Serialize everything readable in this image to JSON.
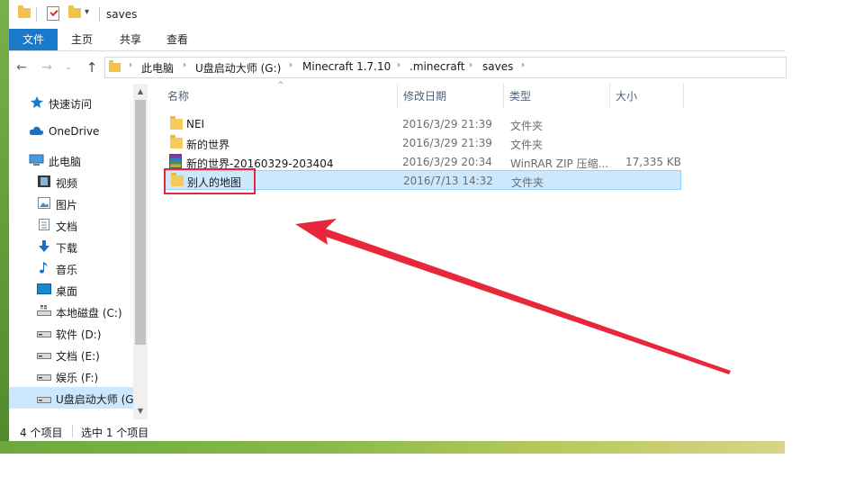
{
  "window": {
    "title": "saves",
    "qat_dropdown": "▾"
  },
  "ribbon": {
    "tabs": [
      {
        "label": "文件",
        "active": true
      },
      {
        "label": "主页"
      },
      {
        "label": "共享"
      },
      {
        "label": "查看"
      }
    ]
  },
  "nav": {
    "back": "←",
    "forward": "→",
    "history": "⌄",
    "up": "↑"
  },
  "address": {
    "crumbs": [
      "此电脑",
      "U盘启动大师 (G:)",
      "Minecraft 1.7.10",
      ".minecraft",
      "saves"
    ],
    "separator": "›"
  },
  "sidebar": {
    "items": [
      {
        "label": "快速访问",
        "icon": "star-icon"
      },
      {
        "label": "OneDrive",
        "icon": "cloud-icon"
      },
      {
        "label": "此电脑",
        "icon": "computer-icon"
      },
      {
        "label": "视频",
        "icon": "video-icon"
      },
      {
        "label": "图片",
        "icon": "picture-icon"
      },
      {
        "label": "文档",
        "icon": "document-icon"
      },
      {
        "label": "下载",
        "icon": "download-icon"
      },
      {
        "label": "音乐",
        "icon": "music-icon"
      },
      {
        "label": "桌面",
        "icon": "desktop-icon"
      },
      {
        "label": "本地磁盘 (C:)",
        "icon": "drive-icon"
      },
      {
        "label": "软件 (D:)",
        "icon": "drive-icon"
      },
      {
        "label": "文档 (E:)",
        "icon": "drive-icon"
      },
      {
        "label": "娱乐 (F:)",
        "icon": "drive-icon"
      },
      {
        "label": "U盘启动大师 (G",
        "icon": "drive-icon",
        "selected": true
      }
    ],
    "scroll_up": "▲",
    "scroll_down": "▼"
  },
  "filelist": {
    "sort_indicator": "^",
    "columns": [
      "名称",
      "修改日期",
      "类型",
      "大小"
    ],
    "rows": [
      {
        "name": "NEI",
        "date": "2016/3/29 21:39",
        "type": "文件夹",
        "size": "",
        "icon": "folder-icon"
      },
      {
        "name": "新的世界",
        "date": "2016/3/29 21:39",
        "type": "文件夹",
        "size": "",
        "icon": "folder-icon"
      },
      {
        "name": "新的世界-20160329-203404",
        "date": "2016/3/29 20:34",
        "type": "WinRAR ZIP 压缩...",
        "size": "17,335 KB",
        "icon": "winrar-archive-icon"
      },
      {
        "name": "别人的地图",
        "date": "2016/7/13 14:32",
        "type": "文件夹",
        "size": "",
        "icon": "folder-icon",
        "selected": true
      }
    ]
  },
  "status": {
    "count": "4 个项目",
    "selected": "选中 1 个项目"
  },
  "annotation": {
    "color": "#e8283a"
  },
  "colors": {
    "accent": "#1979ca",
    "selection": "#cce8ff"
  }
}
